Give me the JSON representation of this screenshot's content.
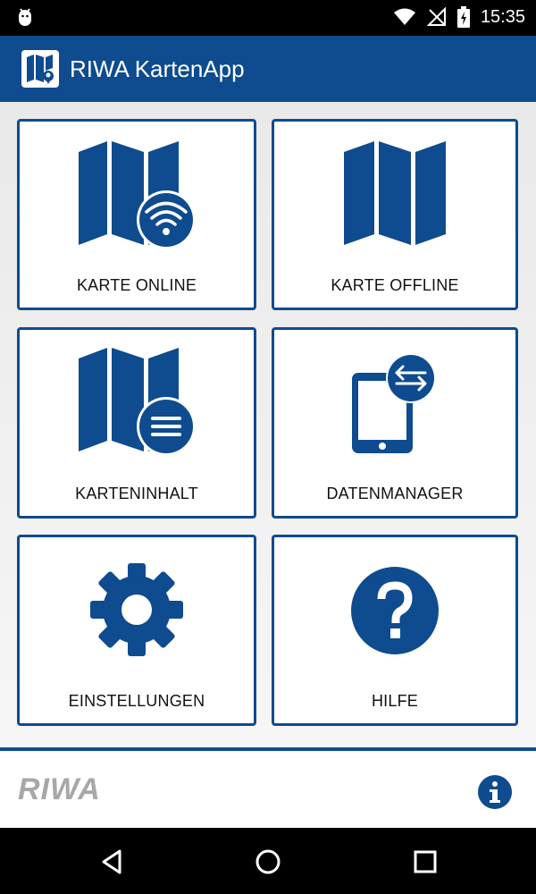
{
  "status_bar": {
    "time": "15:35",
    "icons": [
      "android-debug-icon",
      "wifi-icon",
      "no-signal-icon",
      "battery-charging-icon"
    ]
  },
  "app_bar": {
    "title": "RIWA KartenApp",
    "icon": "map-pin-app-icon"
  },
  "tiles": [
    {
      "label": "KARTE ONLINE",
      "icon": "map-wifi-icon"
    },
    {
      "label": "KARTE OFFLINE",
      "icon": "map-icon"
    },
    {
      "label": "KARTENINHALT",
      "icon": "map-list-icon"
    },
    {
      "label": "DATENMANAGER",
      "icon": "tablet-sync-icon"
    },
    {
      "label": "EINSTELLUNGEN",
      "icon": "gear-icon"
    },
    {
      "label": "HILFE",
      "icon": "help-icon"
    }
  ],
  "footer": {
    "brand": "RIWA",
    "info_icon": "info-icon"
  },
  "nav_bar": {
    "buttons": [
      "back-icon",
      "home-icon",
      "recents-icon"
    ]
  },
  "colors": {
    "primary": "#0e4b8f",
    "status_bar": "#000000",
    "brand_gray": "#a7a7a7"
  }
}
